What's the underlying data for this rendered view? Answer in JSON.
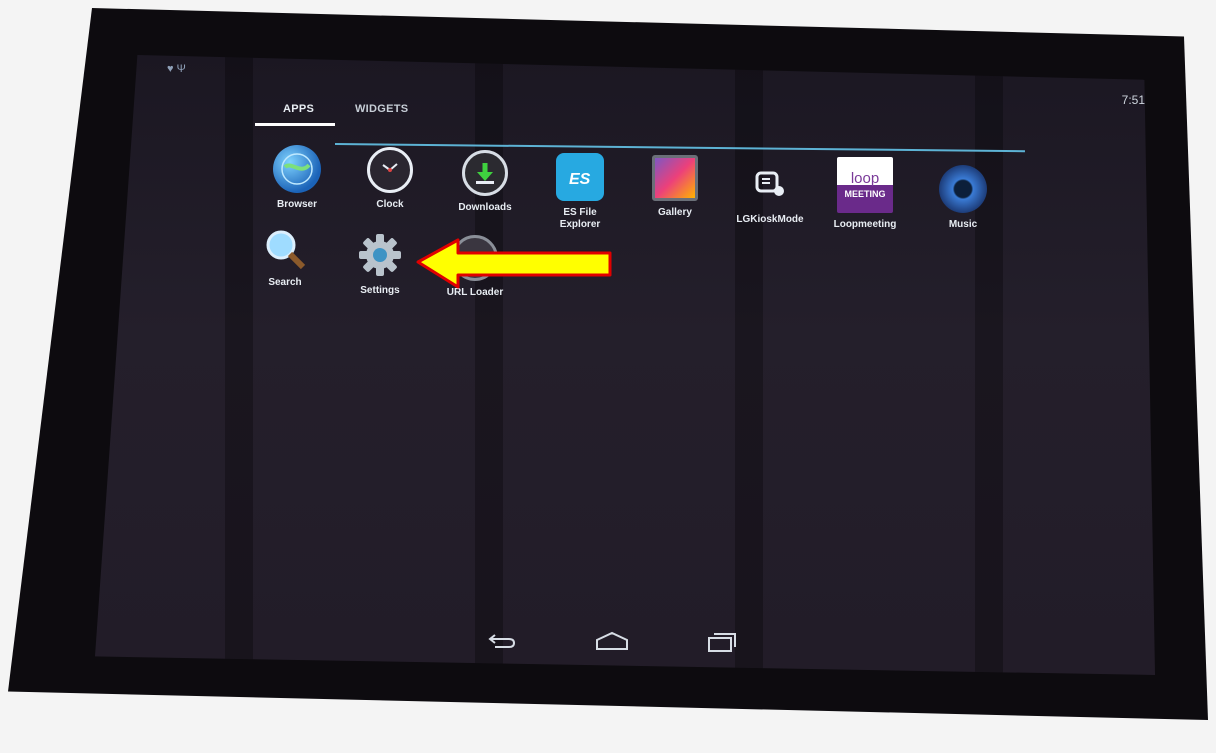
{
  "status": {
    "left_icons": "♥ Ψ",
    "time": "7:51"
  },
  "tabs": {
    "apps": "APPS",
    "widgets": "WIDGETS"
  },
  "apps": [
    {
      "label": "Browser",
      "icon": "globe-icon"
    },
    {
      "label": "Clock",
      "icon": "clock-icon"
    },
    {
      "label": "Downloads",
      "icon": "download-icon"
    },
    {
      "label": "ES File Explorer",
      "icon": "folder-icon"
    },
    {
      "label": "Gallery",
      "icon": "gallery-icon"
    },
    {
      "label": "LGKioskMode",
      "icon": "kiosk-icon"
    },
    {
      "label": "Loopmeeting",
      "icon": "loopmeeting-icon",
      "logo_text": "loop",
      "logo_subtext": "MEETING"
    },
    {
      "label": "Music",
      "icon": "music-icon"
    },
    {
      "label": "Search",
      "icon": "search-icon"
    },
    {
      "label": "Settings",
      "icon": "gear-icon"
    },
    {
      "label": "URL Loader",
      "icon": "url-loader-icon"
    }
  ],
  "nav": {
    "back": "back-icon",
    "home": "home-icon",
    "recents": "recents-icon"
  },
  "colors": {
    "accent": "#5db3d5",
    "arrow_fill": "#ffff00",
    "arrow_stroke": "#e00000"
  }
}
